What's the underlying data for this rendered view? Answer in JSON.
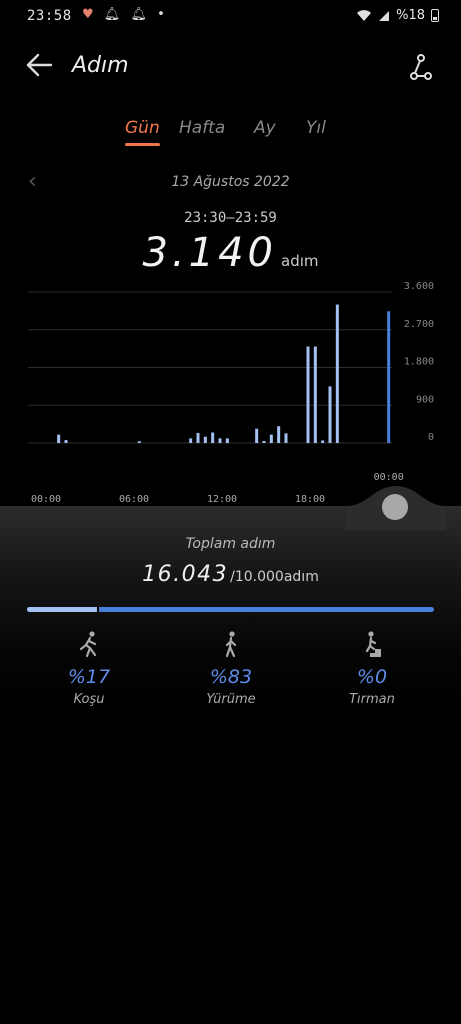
{
  "status": {
    "time": "23:58",
    "battery": "%18"
  },
  "appbar": {
    "title": "Adım"
  },
  "tabs": [
    {
      "label": "Gün",
      "active": true
    },
    {
      "label": "Hafta",
      "active": false
    },
    {
      "label": "Ay",
      "active": false
    },
    {
      "label": "Yıl",
      "active": false
    }
  ],
  "date": "13 Ağustos 2022",
  "selected": {
    "range": "23:30–23:59",
    "value": "3.140",
    "unit": "adım"
  },
  "chart_data": {
    "type": "bar",
    "y_ticks": [
      "3.600",
      "2.700",
      "1.800",
      "900",
      "0"
    ],
    "ylim": [
      0,
      3600
    ],
    "x_ticks": [
      "00:00",
      "06:00",
      "12:00",
      "18:00"
    ],
    "selected_tick": "00:00",
    "bar_color": "#a3c1f1",
    "selected_color": "#4a80dc",
    "values": [
      {
        "time": 1.0,
        "value": 200
      },
      {
        "time": 1.5,
        "value": 70
      },
      {
        "time": 6.5,
        "value": 40
      },
      {
        "time": 10.0,
        "value": 110
      },
      {
        "time": 10.5,
        "value": 240
      },
      {
        "time": 11.0,
        "value": 150
      },
      {
        "time": 11.5,
        "value": 250
      },
      {
        "time": 12.0,
        "value": 110
      },
      {
        "time": 12.5,
        "value": 110
      },
      {
        "time": 14.5,
        "value": 340
      },
      {
        "time": 15.0,
        "value": 50
      },
      {
        "time": 15.5,
        "value": 200
      },
      {
        "time": 16.0,
        "value": 400
      },
      {
        "time": 16.5,
        "value": 230
      },
      {
        "time": 18.0,
        "value": 2300
      },
      {
        "time": 18.5,
        "value": 2300
      },
      {
        "time": 19.0,
        "value": 60
      },
      {
        "time": 19.5,
        "value": 1350
      },
      {
        "time": 20.0,
        "value": 3300
      },
      {
        "time": 23.5,
        "value": 3140,
        "selected": true
      }
    ]
  },
  "summary": {
    "label": "Toplam adım",
    "value": "16.043",
    "goal": "/10.000adım",
    "progress": 1.0
  },
  "activities": [
    {
      "pct": "%17",
      "label": "Koşu",
      "icon": "running-icon"
    },
    {
      "pct": "%83",
      "label": "Yürüme",
      "icon": "walking-icon"
    },
    {
      "pct": "%0",
      "label": "Tırman",
      "icon": "climbing-icon"
    }
  ],
  "colors": {
    "accent": "#f0774c",
    "blue": "#5f8be8"
  }
}
